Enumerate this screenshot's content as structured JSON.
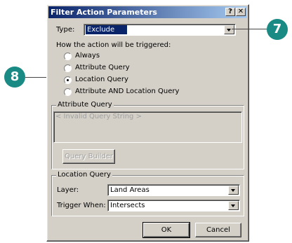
{
  "dialog": {
    "title": "Filter Action Parameters",
    "help_button": "?",
    "close_button": "✕",
    "type_label": "Type:",
    "type_value": "Exclude",
    "trigger_heading": "How the action will be triggered:",
    "trigger_options": [
      {
        "label": "Always",
        "checked": false
      },
      {
        "label": "Attribute Query",
        "checked": false
      },
      {
        "label": "Location Query",
        "checked": true
      },
      {
        "label": "Attribute AND Location Query",
        "checked": false
      }
    ],
    "attribute_query": {
      "group_title": "Attribute Query",
      "query_text": "< Invalid Query String >",
      "builder_button": "Query Builder"
    },
    "location_query": {
      "group_title": "Location Query",
      "layer_label": "Layer:",
      "layer_value": "Land Areas",
      "trigger_label": "Trigger When:",
      "trigger_value": "Intersects"
    },
    "ok_button": "OK",
    "cancel_button": "Cancel"
  },
  "callouts": {
    "step_7": "7",
    "step_8": "8"
  },
  "colors": {
    "callout": "#1a8a84",
    "titlebar_start": "#0a246a",
    "titlebar_end": "#a6caf0",
    "dialog_face": "#d4d0c8"
  }
}
